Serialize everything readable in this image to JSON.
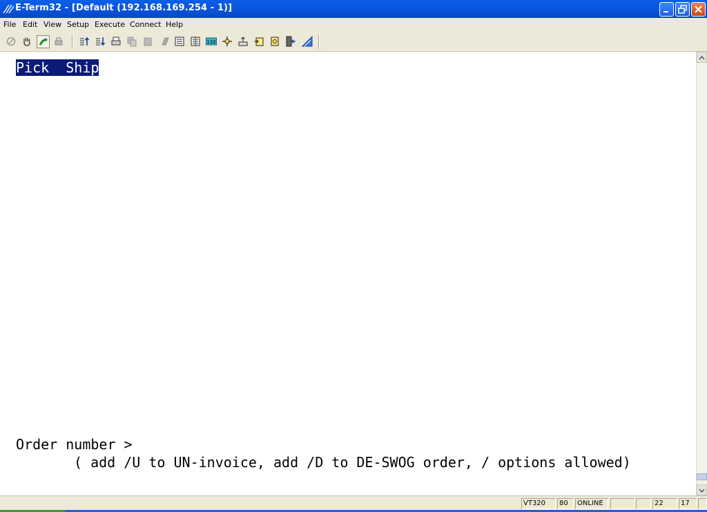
{
  "window": {
    "title": "E-Term32 - [Default (192.168.169.254 - 1)]"
  },
  "menu": {
    "items": [
      "File",
      "Edit",
      "View",
      "Setup",
      "Execute",
      "Connect",
      "Help"
    ]
  },
  "toolbar": {
    "buttons": [
      "disconnect-icon",
      "hand-icon",
      "connect-icon",
      "printer-fax-icon",
      "send-up-icon",
      "receive-down-icon",
      "print-icon",
      "copy-icon",
      "paste-icon",
      "erase-icon",
      "page-icon",
      "page-columns-icon",
      "132-column-icon",
      "move-icon",
      "transfer-icon",
      "script-icon",
      "capture-icon",
      "exit-door-icon",
      "about-icon"
    ],
    "badge_132": "132"
  },
  "terminal": {
    "line1_pick": "Pick",
    "line1_ship": "Ship",
    "prompt": "Order number >",
    "hint": "( add /U to UN-invoice, add /D to DE-SWOG order, / options allowed)"
  },
  "status": {
    "emulation": "VT320",
    "columns": "80",
    "state": "ONLINE",
    "row": "22",
    "col": "17"
  },
  "colors": {
    "titlebar": "#0a57e0",
    "highlight_bg": "#0c1a78",
    "chrome": "#ece9d8"
  }
}
